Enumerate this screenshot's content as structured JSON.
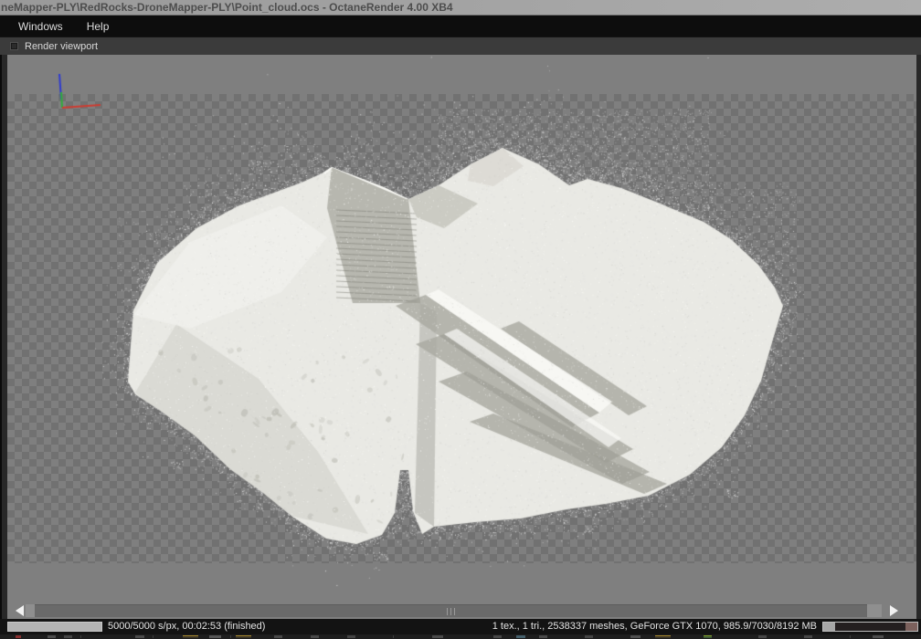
{
  "window": {
    "title": "neMapper-PLY\\RedRocks-DroneMapper-PLY\\Point_cloud.ocs - OctaneRender 4.00 XB4"
  },
  "menu": {
    "items": [
      {
        "label": "Windows"
      },
      {
        "label": "Help"
      }
    ]
  },
  "tabs": [
    {
      "label": "Render viewport"
    }
  ],
  "status": {
    "progress_text": "5000/5000 s/px, 00:02:53 (finished)",
    "progress_fraction": 1.0,
    "device_text": "1 tex., 1 tri., 2538337 meshes, GeForce GTX 1070, 985.9/7030/8192 MB",
    "memory_used_fraction": 0.13,
    "memory_reserved_fraction": 0.13
  },
  "colors": {
    "axis_x_red": "#cf3b30",
    "axis_y_green": "#2fae3a",
    "axis_z_blue": "#2f3bd0",
    "progress_fill": "#b3b3b3",
    "memory_used": "#a7a7a7",
    "memory_reserved": "#7c615d",
    "viewport_gray": "#7f7f7f",
    "checker_dark": "#717171"
  }
}
